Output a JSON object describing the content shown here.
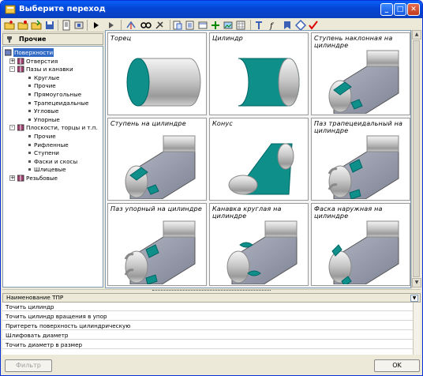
{
  "window": {
    "title": "Выберите переход"
  },
  "title_buttons": {
    "minimize": "_",
    "maximize": "□",
    "close": "✕"
  },
  "toolbar_icons": [
    "new-folder-icon",
    "new-item-icon",
    "open-icon",
    "save-icon",
    "properties-icon",
    "tools-icon",
    "run-icon",
    "filter-icon",
    "search-icon",
    "settings-icon",
    "copy-icon",
    "cut-icon",
    "paste-icon",
    "insert-icon",
    "add-icon",
    "image-icon",
    "grid-icon",
    "text-icon",
    "refresh-icon",
    "bookmark-icon",
    "checkmark-icon"
  ],
  "left_panel": {
    "header": "Прочие"
  },
  "tree": [
    {
      "label": "Поверхности",
      "level": 0,
      "selected": true,
      "icon": "folder-surface-icon"
    },
    {
      "label": "Отверстия",
      "level": 1,
      "expander": "+",
      "icon": "book-icon"
    },
    {
      "label": "Пазы и канавки",
      "level": 1,
      "expander": "-",
      "icon": "book-open-icon"
    },
    {
      "label": "Круглые",
      "level": 2
    },
    {
      "label": "Прочие",
      "level": 2
    },
    {
      "label": "Прямоугольные",
      "level": 2
    },
    {
      "label": "Трапецеидальные",
      "level": 2
    },
    {
      "label": "Угловые",
      "level": 2
    },
    {
      "label": "Упорные",
      "level": 2
    },
    {
      "label": "Плоскости, торцы и т.п.",
      "level": 1,
      "expander": "-",
      "icon": "book-open-icon"
    },
    {
      "label": "Прочие",
      "level": 2
    },
    {
      "label": "Рифленные",
      "level": 2
    },
    {
      "label": "Ступени",
      "level": 2
    },
    {
      "label": "Фаски и скосы",
      "level": 2
    },
    {
      "label": "Шлицевые",
      "level": 2
    },
    {
      "label": "Резьбовые",
      "level": 1,
      "expander": "+",
      "icon": "book-icon"
    }
  ],
  "cards": [
    {
      "caption": "Торец",
      "shape": "cylinder-end"
    },
    {
      "caption": "Цилиндр",
      "shape": "cylinder"
    },
    {
      "caption": "Ступень наклонная на цилиндре",
      "shape": "step-inclined"
    },
    {
      "caption": "Ступень на цилиндре",
      "shape": "step"
    },
    {
      "caption": "Конус",
      "shape": "cone"
    },
    {
      "caption": "Паз трапецеидальный на цилиндре",
      "shape": "groove-trap"
    },
    {
      "caption": "Паз упорный на цилиндре",
      "shape": "groove-thrust"
    },
    {
      "caption": "Канавка круглая на цилиндре",
      "shape": "groove-round"
    },
    {
      "caption": "Фаска наружная на цилиндре",
      "shape": "chamfer"
    }
  ],
  "operations": {
    "header": "Наименование ТПР",
    "rows": [
      "Точить цилиндр",
      "Точить цилиндр вращения в упор",
      "Притереть поверхность цилиндрическую",
      "Шлифовать диаметр",
      "Точить диаметр в размер"
    ]
  },
  "buttons": {
    "filter": "Фильтр",
    "ok": "OK"
  },
  "colors": {
    "teal": "#0f8f8a",
    "title_blue": "#0a5ef7",
    "selection": "#316ac5"
  }
}
